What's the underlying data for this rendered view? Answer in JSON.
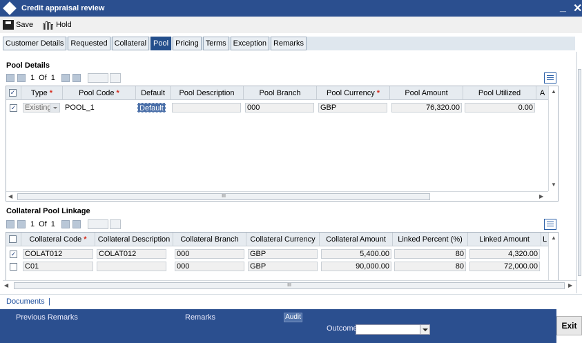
{
  "window": {
    "title": "Credit appraisal review",
    "minimize_label": "_",
    "close_label": "✕"
  },
  "toolbar": {
    "save_label": "Save",
    "hold_label": "Hold"
  },
  "tabs": [
    "Customer Details",
    "Requested",
    "Collateral",
    "Pool",
    "Pricing",
    "Terms",
    "Exception",
    "Remarks"
  ],
  "active_tab": "Pool",
  "pool_details": {
    "title": "Pool Details",
    "pagination": {
      "current": "1",
      "of_label": "Of",
      "total": "1"
    },
    "columns": [
      "Type",
      "Pool Code",
      "Default",
      "Pool Description",
      "Pool Branch",
      "Pool Currency",
      "Pool Amount",
      "Pool Utilized",
      "A"
    ],
    "required": [
      "Type",
      "Pool Code",
      "Pool Currency"
    ],
    "rows": [
      {
        "checked": true,
        "type": "Existing",
        "pool_code": "POOL_1",
        "default": "Default",
        "pool_description": "",
        "pool_branch": "000",
        "pool_currency": "GBP",
        "pool_amount": "76,320.00",
        "pool_utilized": "0.00"
      }
    ],
    "hscroll_label": "III"
  },
  "collateral_pool_linkage": {
    "title": "Collateral Pool Linkage",
    "pagination": {
      "current": "1",
      "of_label": "Of",
      "total": "1"
    },
    "columns": [
      "Collateral Code",
      "Collateral Description",
      "Collateral Branch",
      "Collateral Currency",
      "Collateral Amount",
      "Linked Percent (%)",
      "Linked Amount",
      "L"
    ],
    "required": [
      "Collateral Code"
    ],
    "rows": [
      {
        "checked": true,
        "code": "COLAT012",
        "description": "COLAT012",
        "branch": "000",
        "currency": "GBP",
        "amount": "5,400.00",
        "linked_percent": "80",
        "linked_amount": "4,320.00"
      },
      {
        "checked": false,
        "code": "C01",
        "description": "",
        "branch": "000",
        "currency": "GBP",
        "amount": "90,000.00",
        "linked_percent": "80",
        "linked_amount": "72,000.00"
      }
    ],
    "hscroll_label": "III"
  },
  "footer": {
    "documents_label": "Documents",
    "separator": "|"
  },
  "bottom": {
    "previous_remarks": "Previous Remarks",
    "remarks": "Remarks",
    "audit": "Audit",
    "outcome_label": "Outcome",
    "outcome_value": "",
    "exit": "Exit"
  },
  "colors": {
    "header_blue": "#2b4f8f",
    "tab_active": "#244f8c",
    "required_star": "#d62a1b"
  }
}
